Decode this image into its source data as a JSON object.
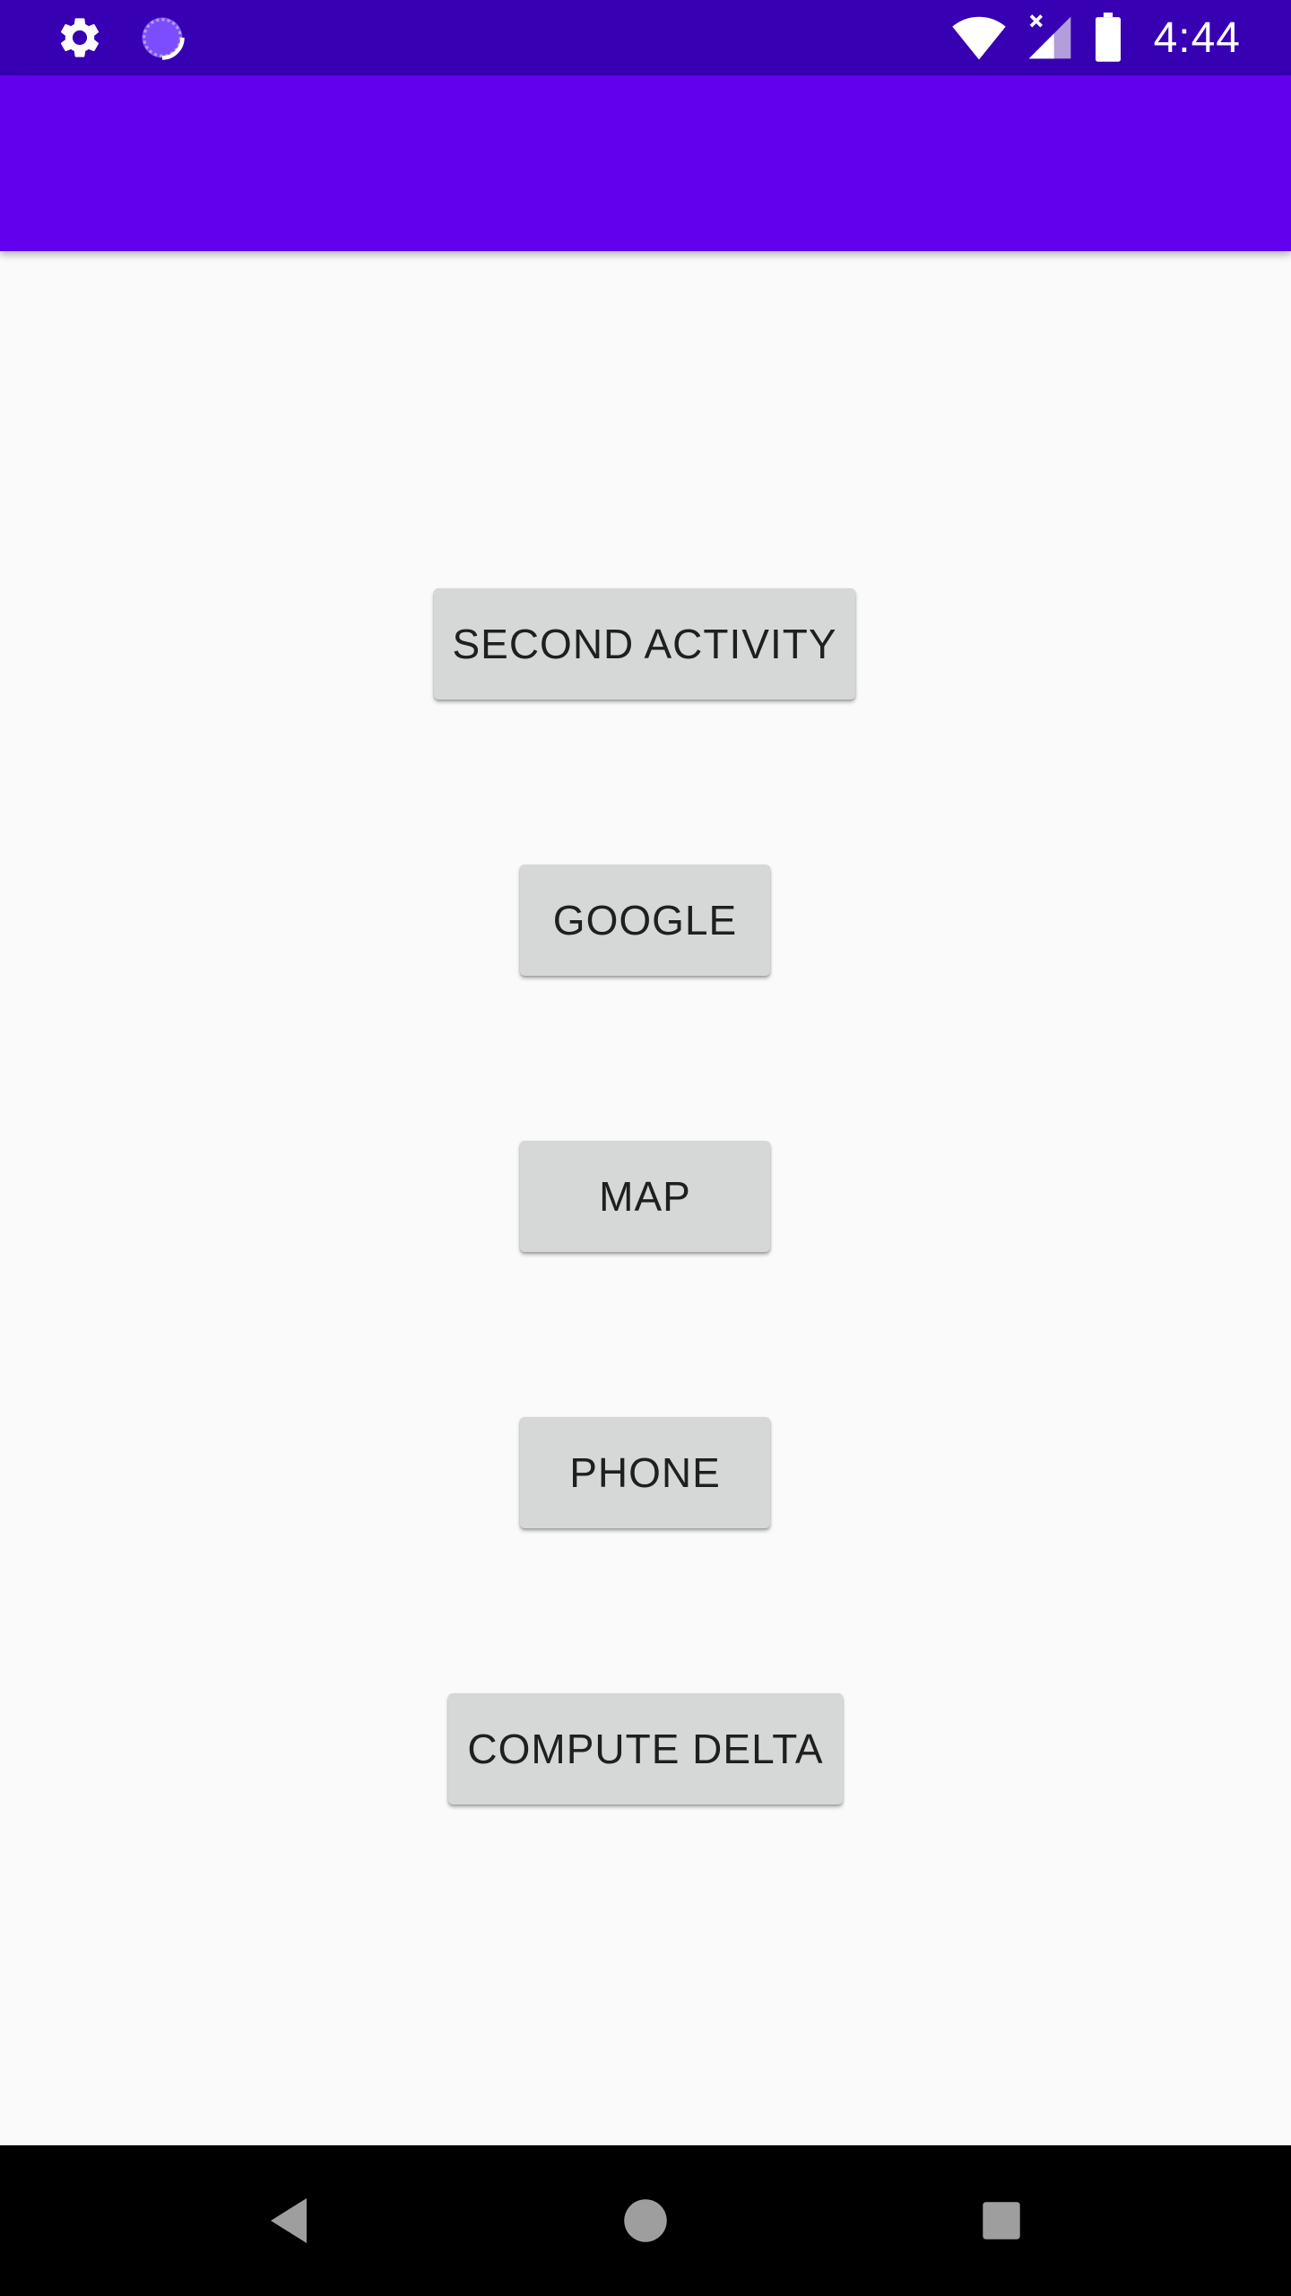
{
  "status_bar": {
    "time": "4:44",
    "icons": [
      "gear-icon",
      "sync-icon",
      "wifi-icon",
      "signal-icon",
      "battery-icon"
    ]
  },
  "app_bar": {
    "color": "#6200ee",
    "status_color": "#3700b3"
  },
  "buttons": {
    "second_activity": "SECOND ACTIVITY",
    "google": "GOOGLE",
    "map": "MAP",
    "phone": "PHONE",
    "compute_delta": "COMPUTE DELTA"
  },
  "nav_bar": {
    "icons": [
      "back-icon",
      "home-icon",
      "recents-icon"
    ]
  }
}
